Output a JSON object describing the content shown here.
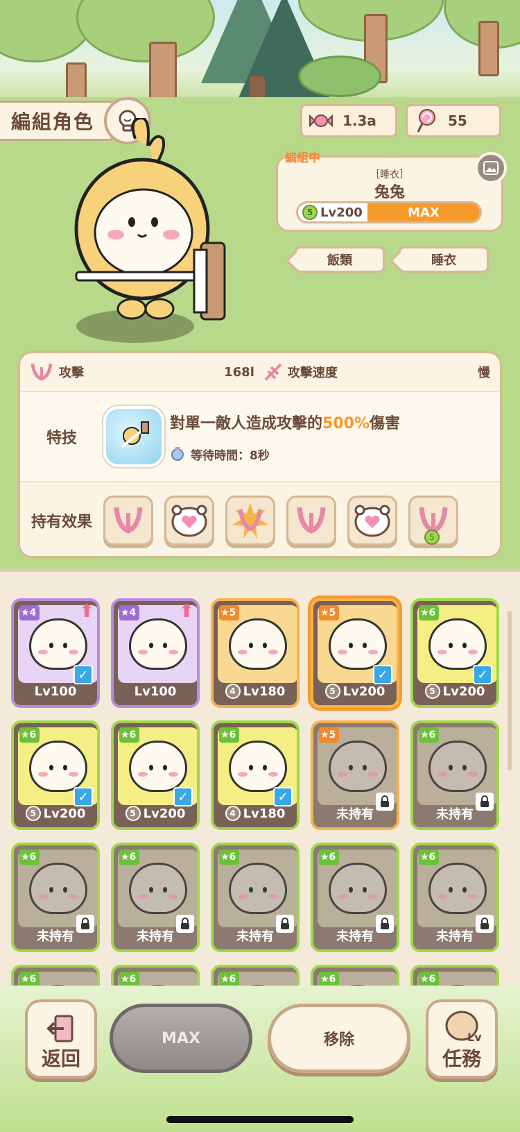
{
  "header": {
    "title": "編組角色",
    "currencies": [
      {
        "icon": "candy-icon",
        "value": "1.3a"
      },
      {
        "icon": "lollipop-icon",
        "value": "55"
      }
    ]
  },
  "character": {
    "status": "編組中",
    "costume": "［睡衣］",
    "name": "兔兔",
    "level_rank": "5",
    "level": "Lv200",
    "level_state": "MAX",
    "level_progress": 1.0,
    "tags": [
      "飯類",
      "睡衣"
    ]
  },
  "stats": {
    "attack_label": "攻擊",
    "attack_value": "168l",
    "speed_label": "攻擊速度",
    "speed_value": "慢",
    "skill_label": "特技",
    "skill_desc_prefix": "對單一敵人造成攻擊的",
    "skill_desc_percent": "500%",
    "skill_desc_suffix": "傷害",
    "cooldown": "等待時間：8秒",
    "effects_label": "持有效果",
    "effects": [
      "attack-claw-icon",
      "heart-bear-icon",
      "attack-burst-icon",
      "attack-claw-icon",
      "heart-bear-icon",
      "attack-claw-rank5-icon"
    ],
    "effect_badge": "5"
  },
  "roster": {
    "cards": [
      {
        "stars": "4",
        "frame": "purple",
        "footer": "Lv100",
        "owned": true,
        "checked": true,
        "upgrade": true
      },
      {
        "stars": "4",
        "frame": "purple",
        "footer": "Lv100",
        "owned": true,
        "checked": false,
        "upgrade": true
      },
      {
        "stars": "5",
        "frame": "orange",
        "footer": "Lv180",
        "rank": "4",
        "owned": true,
        "checked": false
      },
      {
        "stars": "5",
        "frame": "orange",
        "footer": "Lv200",
        "rank": "5",
        "owned": true,
        "checked": true,
        "selected": true
      },
      {
        "stars": "6",
        "frame": "green",
        "footer": "Lv200",
        "rank": "5",
        "owned": true,
        "checked": true
      },
      {
        "stars": "6",
        "frame": "green",
        "footer": "Lv200",
        "rank": "5",
        "owned": true,
        "checked": true
      },
      {
        "stars": "6",
        "frame": "green",
        "footer": "Lv200",
        "rank": "5",
        "owned": true,
        "checked": true
      },
      {
        "stars": "6",
        "frame": "green",
        "footer": "Lv180",
        "rank": "4",
        "owned": true,
        "checked": true
      },
      {
        "stars": "5",
        "frame": "orange",
        "footer": "未持有",
        "owned": false
      },
      {
        "stars": "6",
        "frame": "green",
        "footer": "未持有",
        "owned": false
      },
      {
        "stars": "6",
        "frame": "green",
        "footer": "未持有",
        "owned": false
      },
      {
        "stars": "6",
        "frame": "green",
        "footer": "未持有",
        "owned": false
      },
      {
        "stars": "6",
        "frame": "green",
        "footer": "未持有",
        "owned": false
      },
      {
        "stars": "6",
        "frame": "green",
        "footer": "未持有",
        "owned": false
      },
      {
        "stars": "6",
        "frame": "green",
        "footer": "未持有",
        "owned": false
      },
      {
        "stars": "6",
        "frame": "green",
        "footer": "",
        "owned": false
      },
      {
        "stars": "6",
        "frame": "green",
        "footer": "",
        "owned": false
      },
      {
        "stars": "6",
        "frame": "green",
        "footer": "",
        "owned": false
      },
      {
        "stars": "6",
        "frame": "green",
        "footer": "",
        "owned": false
      },
      {
        "stars": "6",
        "frame": "green",
        "footer": "",
        "owned": false
      }
    ]
  },
  "bottom": {
    "back_label": "返回",
    "max_label": "MAX",
    "remove_label": "移除",
    "mission_label": "任務",
    "mission_sub": "Lv"
  },
  "colors": {
    "accent": "#f59a2b",
    "frame_purple": "#b98be0",
    "frame_orange": "#f7b24a",
    "frame_green": "#9fd84a",
    "check": "#38a8e8"
  }
}
